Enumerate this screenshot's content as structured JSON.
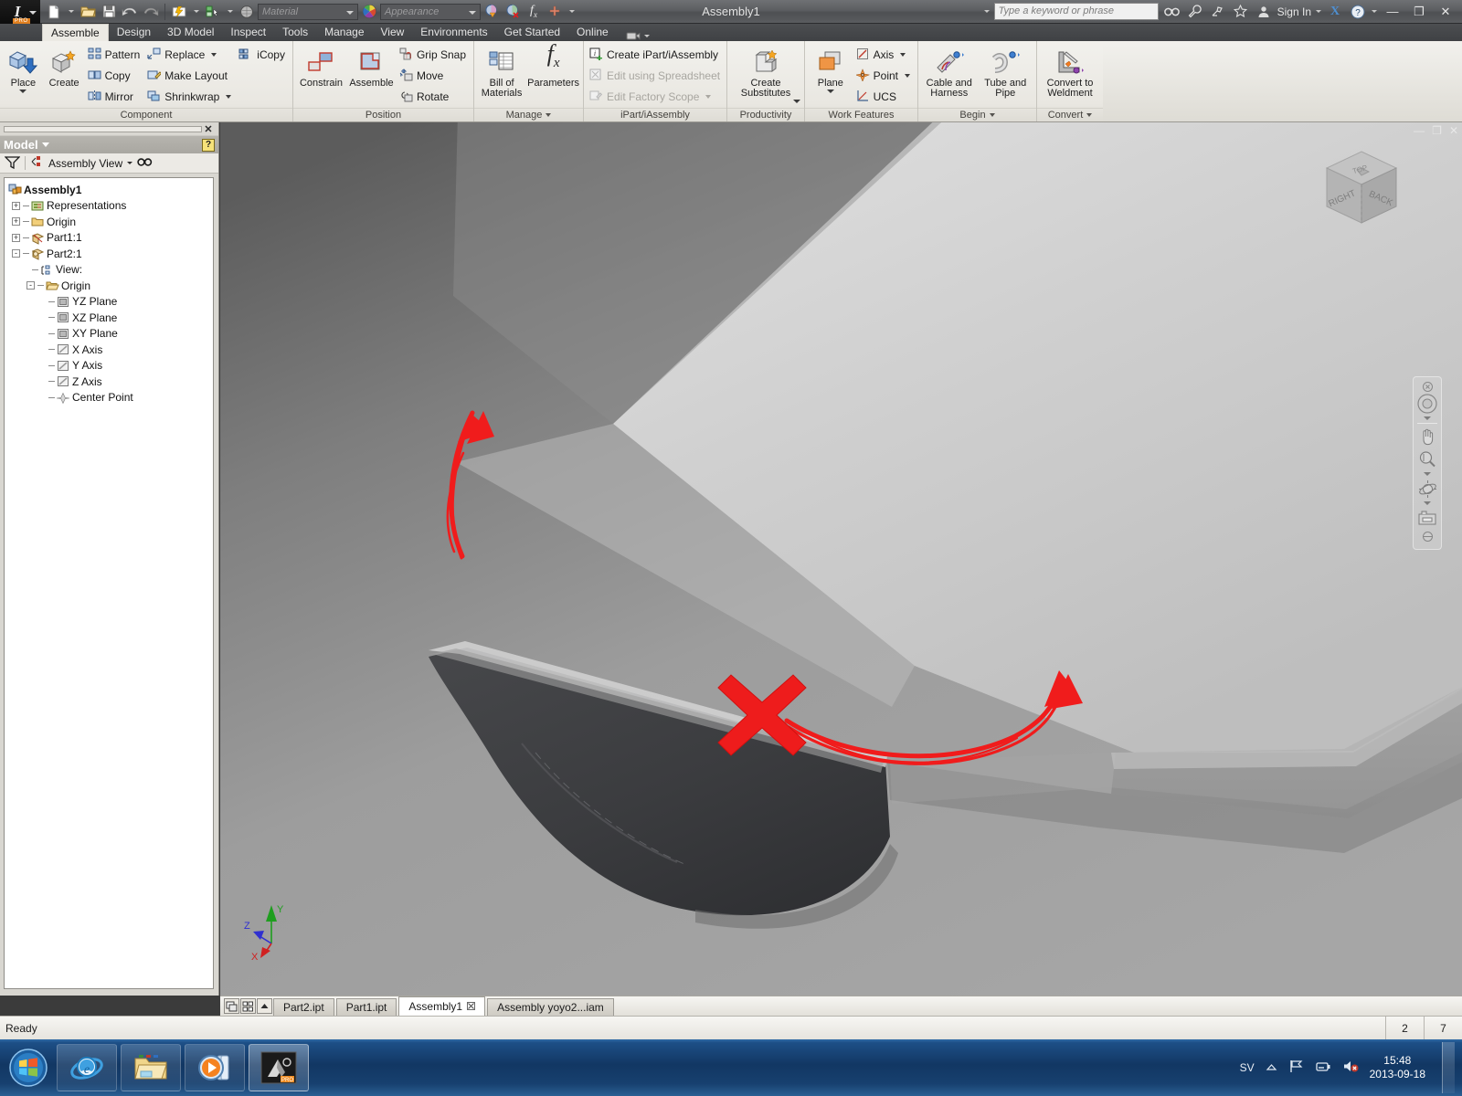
{
  "window": {
    "title": "Assembly1",
    "minimize": "—",
    "restore": "❐",
    "close": "✕"
  },
  "quick_access": {
    "new_label": "New",
    "open_label": "Open",
    "save_label": "Save",
    "undo_label": "Undo",
    "redo_label": "Redo",
    "material_placeholder": "Material",
    "appearance_placeholder": "Appearance"
  },
  "search": {
    "placeholder": "Type a keyword or phrase",
    "sign_in": "Sign In",
    "help": "?"
  },
  "ribbon": {
    "tabs": [
      {
        "label": "Assemble",
        "active": true
      },
      {
        "label": "Design",
        "active": false
      },
      {
        "label": "3D Model",
        "active": false
      },
      {
        "label": "Inspect",
        "active": false
      },
      {
        "label": "Tools",
        "active": false
      },
      {
        "label": "Manage",
        "active": false
      },
      {
        "label": "View",
        "active": false
      },
      {
        "label": "Environments",
        "active": false
      },
      {
        "label": "Get Started",
        "active": false
      },
      {
        "label": "Online",
        "active": false
      }
    ],
    "panels": [
      {
        "title": "Component",
        "big": [
          {
            "label": "Place",
            "icon": "place-component-icon",
            "dropdown": true
          },
          {
            "label": "Create",
            "icon": "create-component-icon",
            "dropdown": false
          }
        ],
        "columns": [
          [
            {
              "label": "Pattern",
              "icon": "pattern-icon",
              "dropdown": false,
              "disabled": false
            },
            {
              "label": "Copy",
              "icon": "copy-icon",
              "dropdown": false,
              "disabled": false
            },
            {
              "label": "Mirror",
              "icon": "mirror-icon",
              "dropdown": false,
              "disabled": false
            }
          ],
          [
            {
              "label": "Replace",
              "icon": "replace-icon",
              "dropdown": true,
              "disabled": false
            },
            {
              "label": "Make Layout",
              "icon": "make-layout-icon",
              "dropdown": false,
              "disabled": false
            },
            {
              "label": "Shrinkwrap",
              "icon": "shrinkwrap-icon",
              "dropdown": true,
              "disabled": false
            }
          ],
          [
            {
              "label": "iCopy",
              "icon": "icopy-icon",
              "dropdown": false,
              "disabled": false
            }
          ]
        ]
      },
      {
        "title": "Position",
        "big": [
          {
            "label": "Constrain",
            "icon": "constrain-icon",
            "dropdown": false
          },
          {
            "label": "Assemble",
            "icon": "assemble-icon",
            "dropdown": false
          }
        ],
        "columns": [
          [
            {
              "label": "Grip Snap",
              "icon": "grip-snap-icon",
              "dropdown": false,
              "disabled": false
            },
            {
              "label": "Move",
              "icon": "move-icon",
              "dropdown": false,
              "disabled": false
            },
            {
              "label": "Rotate",
              "icon": "rotate-icon",
              "dropdown": false,
              "disabled": false
            }
          ]
        ]
      },
      {
        "title": "Manage",
        "title_dropdown": true,
        "big": [
          {
            "label": "Bill of Materials",
            "icon": "bill-of-materials-icon",
            "dropdown": false
          },
          {
            "label": "Parameters",
            "icon": "parameters-icon",
            "dropdown": false
          }
        ],
        "columns": []
      },
      {
        "title": "iPart/iAssembly",
        "big": [],
        "columns": [
          [
            {
              "label": "Create iPart/iAssembly",
              "icon": "create-ipart-icon",
              "dropdown": false,
              "disabled": false
            },
            {
              "label": "Edit using Spreadsheet",
              "icon": "edit-spreadsheet-icon",
              "dropdown": false,
              "disabled": true
            },
            {
              "label": "Edit Factory Scope",
              "icon": "edit-factory-scope-icon",
              "dropdown": true,
              "disabled": true
            }
          ]
        ]
      },
      {
        "title": "Productivity",
        "big": [
          {
            "label": "Create Substitutes",
            "icon": "create-substitutes-icon",
            "dropdown": true
          }
        ],
        "columns": []
      },
      {
        "title": "Work Features",
        "big": [
          {
            "label": "Plane",
            "icon": "plane-icon",
            "dropdown": true
          }
        ],
        "columns": [
          [
            {
              "label": "Axis",
              "icon": "axis-icon",
              "dropdown": true,
              "disabled": false
            },
            {
              "label": "Point",
              "icon": "point-icon",
              "dropdown": true,
              "disabled": false
            },
            {
              "label": "UCS",
              "icon": "ucs-icon",
              "dropdown": false,
              "disabled": false
            }
          ]
        ]
      },
      {
        "title": "Begin",
        "title_dropdown": true,
        "big": [
          {
            "label": "Cable and Harness",
            "icon": "cable-harness-icon",
            "dropdown": false
          },
          {
            "label": "Tube and Pipe",
            "icon": "tube-pipe-icon",
            "dropdown": false
          }
        ],
        "columns": []
      },
      {
        "title": "Convert",
        "title_dropdown": true,
        "big": [
          {
            "label": "Convert to Weldment",
            "icon": "convert-weldment-icon",
            "dropdown": false
          }
        ],
        "columns": []
      }
    ]
  },
  "browser": {
    "panel_title": "Model",
    "close_label": "✕",
    "help_label": "?",
    "filter_label": "filter-icon",
    "view_mode": "Assembly View",
    "search_label": "find-icon",
    "tree": [
      {
        "label": "Assembly1",
        "indent": 0,
        "expander": "",
        "icon": "assembly-icon",
        "bold": true
      },
      {
        "label": "Representations",
        "indent": 1,
        "expander": "+",
        "icon": "representations-icon",
        "bold": false
      },
      {
        "label": "Origin",
        "indent": 1,
        "expander": "+",
        "icon": "folder-icon",
        "bold": false
      },
      {
        "label": "Part1:1",
        "indent": 1,
        "expander": "+",
        "icon": "part-icon",
        "bold": false
      },
      {
        "label": "Part2:1",
        "indent": 1,
        "expander": "-",
        "icon": "part-icon",
        "bold": false
      },
      {
        "label": "View:",
        "indent": 2,
        "expander": "",
        "icon": "view-rep-icon",
        "bold": false
      },
      {
        "label": "Origin",
        "indent": 2,
        "expander": "-",
        "icon": "folder-open-icon",
        "bold": false
      },
      {
        "label": "YZ Plane",
        "indent": 3,
        "expander": "",
        "icon": "workplane-icon",
        "bold": false
      },
      {
        "label": "XZ Plane",
        "indent": 3,
        "expander": "",
        "icon": "workplane-icon",
        "bold": false
      },
      {
        "label": "XY Plane",
        "indent": 3,
        "expander": "",
        "icon": "workplane-icon",
        "bold": false
      },
      {
        "label": "X Axis",
        "indent": 3,
        "expander": "",
        "icon": "workaxis-icon",
        "bold": false
      },
      {
        "label": "Y Axis",
        "indent": 3,
        "expander": "",
        "icon": "workaxis-icon",
        "bold": false
      },
      {
        "label": "Z Axis",
        "indent": 3,
        "expander": "",
        "icon": "workaxis-icon",
        "bold": false
      },
      {
        "label": "Center Point",
        "indent": 3,
        "expander": "",
        "icon": "workpoint-icon",
        "bold": false
      }
    ]
  },
  "viewport": {
    "minimize": "—",
    "restore": "❐",
    "close": "✕",
    "viewcube": {
      "top": "TOP",
      "left_face": "RIGHT",
      "right_face": "BACK"
    },
    "triad": {
      "x": "X",
      "y": "Y",
      "z": "Z"
    },
    "annotations": {
      "cross_mark": "red-x-mark",
      "arrow_left": "red-arrow-up-left",
      "arrow_right": "red-arrow-right"
    },
    "nav_items": [
      "close-icon",
      "steering-wheel-icon",
      "chevron-down-icon",
      "pan-hand-icon",
      "zoom-magnifier-icon",
      "chevron-down-icon",
      "orbit-icon",
      "chevron-down-icon",
      "look-at-camera-icon",
      "chevron-down-icon"
    ]
  },
  "doc_tabs": {
    "tools": [
      "tile-windows-icon",
      "grid-windows-icon",
      "scroll-up-icon"
    ],
    "tabs": [
      {
        "label": "Part2.ipt",
        "active": false,
        "has_close": false
      },
      {
        "label": "Part1.ipt",
        "active": false,
        "has_close": false
      },
      {
        "label": "Assembly1",
        "active": true,
        "has_close": true
      },
      {
        "label": "Assembly yoyo2...iam",
        "active": false,
        "has_close": false
      }
    ]
  },
  "status": {
    "message": "Ready",
    "cell1": "2",
    "cell2": "7"
  },
  "taskbar": {
    "start_label": "start-orb-icon",
    "items": [
      {
        "name": "internet-explorer-icon",
        "active": false
      },
      {
        "name": "windows-explorer-icon",
        "active": false
      },
      {
        "name": "media-player-icon",
        "active": false
      },
      {
        "name": "inventor-icon",
        "active": true
      }
    ],
    "tray": {
      "language": "SV",
      "show_hidden": "show-hidden-icons-icon",
      "network": "network-flag-icon",
      "battery": "battery-icon",
      "volume": "volume-muted-icon",
      "time": "15:48",
      "date": "2013-09-18"
    }
  },
  "colors": {
    "accent_orange": "#ef9545",
    "annotation_red": "#f01c1c",
    "tab_active_bg": "#eceae4",
    "taskbar_blue": "#123763"
  }
}
